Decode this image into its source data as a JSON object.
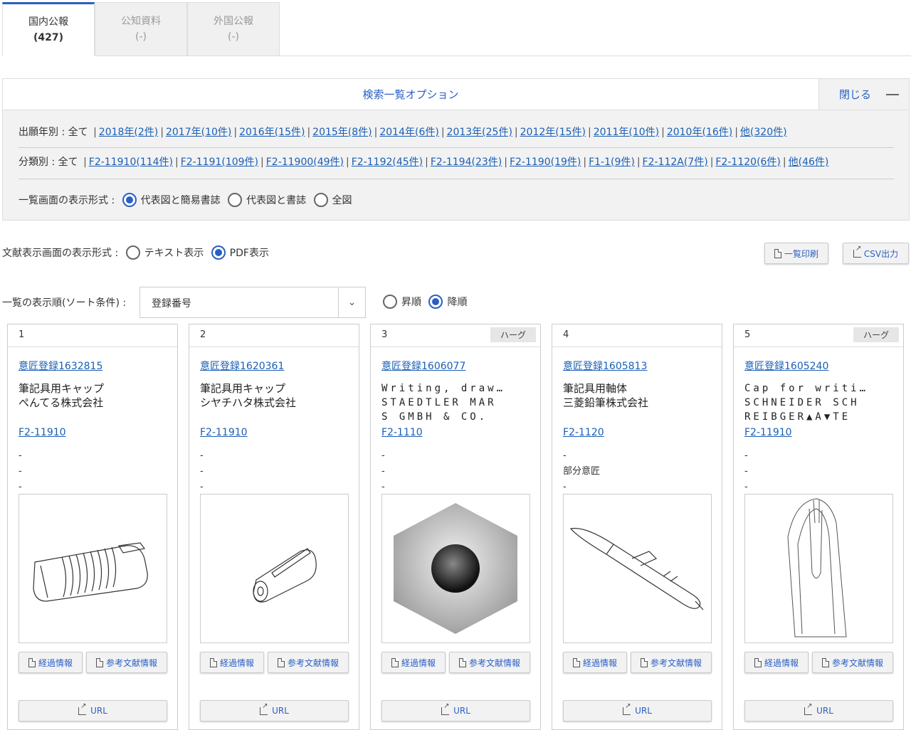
{
  "tabs": [
    {
      "label": "国内公報",
      "count": "(427)"
    },
    {
      "label": "公知資料",
      "count": "(-)"
    },
    {
      "label": "外国公報",
      "count": "(-)"
    }
  ],
  "options": {
    "title": "検索一覧オプション",
    "close_label": "閉じる",
    "year_filter": {
      "label": "出願年別 : 全て",
      "items": [
        "2018年(2件)",
        "2017年(10件)",
        "2016年(15件)",
        "2015年(8件)",
        "2014年(6件)",
        "2013年(25件)",
        "2012年(15件)",
        "2011年(10件)",
        "2010年(16件)",
        "他(320件)"
      ]
    },
    "class_filter": {
      "label": "分類別 : 全て",
      "items": [
        "F2-11910(114件)",
        "F2-1191(109件)",
        "F2-11900(49件)",
        "F2-1192(45件)",
        "F2-1194(23件)",
        "F2-1190(19件)",
        "F1-1(9件)",
        "F2-112A(7件)",
        "F2-1120(6件)",
        "他(46件)"
      ]
    },
    "list_format": {
      "label": "一覧画面の表示形式 :",
      "options": [
        "代表図と簡易書誌",
        "代表図と書誌",
        "全図"
      ],
      "selected": 0
    }
  },
  "doc_format": {
    "label": "文献表示画面の表示形式 :",
    "options": [
      "テキスト表示",
      "PDF表示"
    ],
    "selected": 1
  },
  "toolbar": {
    "print_label": "一覧印刷",
    "csv_label": "CSV出力"
  },
  "sort": {
    "label": "一覧の表示順(ソート条件) :",
    "value": "登録番号",
    "order_options": [
      "昇順",
      "降順"
    ],
    "order_selected": 1
  },
  "cards": [
    {
      "num": "1",
      "tag": "",
      "reg": "意匠登録1632815",
      "title": "筆記具用キャップ\nぺんてる株式会社",
      "mono": false,
      "class": "F2-11910",
      "extra": [
        "-",
        "-",
        "-"
      ],
      "image": "pen-cap-icon"
    },
    {
      "num": "2",
      "tag": "",
      "reg": "意匠登録1620361",
      "title": "筆記具用キャップ\nシヤチハタ株式会社",
      "mono": false,
      "class": "F2-11910",
      "extra": [
        "-",
        "-",
        "-"
      ],
      "image": "cap-clip-icon"
    },
    {
      "num": "3",
      "tag": "ハーグ",
      "reg": "意匠登録1606077",
      "title": "Writing, draw…\nSTAEDTLER MAR\nS GMBH & CO.",
      "mono": true,
      "class": "F2-1110",
      "extra": [
        "-",
        "-",
        "-"
      ],
      "image": "hexagon-pencil-end-icon"
    },
    {
      "num": "4",
      "tag": "",
      "reg": "意匠登録1605813",
      "title": "筆記具用軸体\n三菱鉛筆株式会社",
      "mono": false,
      "class": "F2-1120",
      "extra": [
        "-",
        "部分意匠",
        "-"
      ],
      "image": "ballpoint-pen-icon"
    },
    {
      "num": "5",
      "tag": "ハーグ",
      "reg": "意匠登録1605240",
      "title": "Cap for writi…\nSCHNEIDER SCH\nREIBGER▲A▼TE",
      "mono": true,
      "class": "F2-11910",
      "extra": [
        "-",
        "-",
        "-"
      ],
      "image": "pen-cap-outline-icon"
    }
  ],
  "card_buttons": {
    "history": "経過情報",
    "reference": "参考文献情報",
    "url": "URL"
  },
  "colors": {
    "accent": "#2a5fc4",
    "link": "#1a5fb4"
  }
}
